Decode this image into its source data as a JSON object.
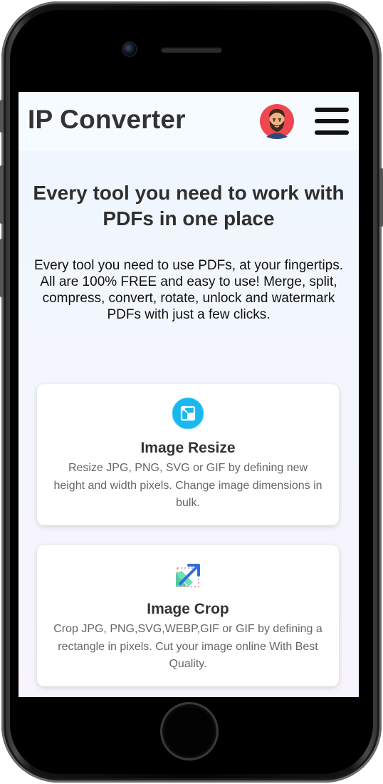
{
  "header": {
    "logo": "IP Converter",
    "avatar_icon": "bearded-man-avatar",
    "menu_icon": "hamburger-menu-icon"
  },
  "hero": {
    "title_line1": "Every tool you need to work with",
    "title_line2": "PDFs in one place",
    "description": "Every tool you need to use PDFs, at your fingertips. All are 100% FREE and easy to use! Merge, split, compress, convert, rotate, unlock and watermark PDFs with just a few clicks."
  },
  "tools": [
    {
      "icon": "image-resize-icon",
      "title": "Image Resize",
      "description": "Resize JPG, PNG, SVG or GIF by defining new height and width pixels. Change image dimensions in bulk."
    },
    {
      "icon": "image-crop-icon",
      "title": "Image Crop",
      "description": "Crop JPG, PNG,SVG,WEBP,GIF or GIF by defining a rectangle in pixels. Cut your image online With Best Quality."
    }
  ],
  "colors": {
    "accent": "#1ab8ee",
    "crop_green": "#4fd1a5",
    "crop_blue": "#2f6fd8",
    "text_dark": "#333333",
    "text_muted": "#666666"
  }
}
